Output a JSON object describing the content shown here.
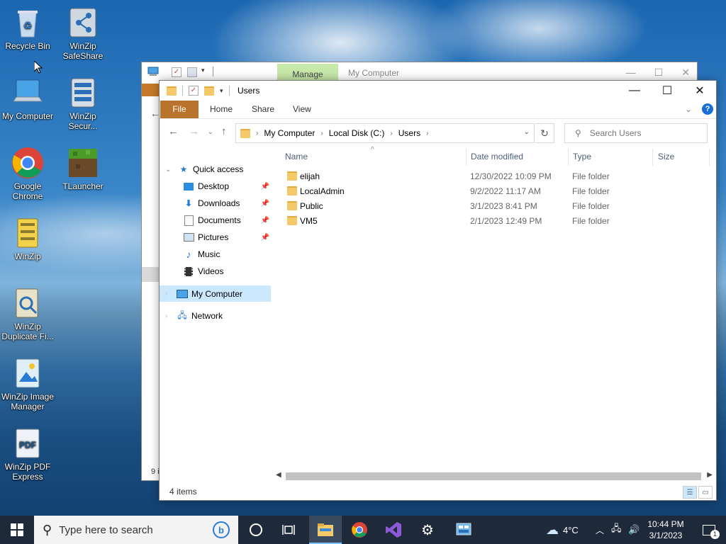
{
  "desktop_icons": [
    {
      "label": "Recycle Bin",
      "icon": "recycle-bin-icon"
    },
    {
      "label": "WinZip SafeShare",
      "icon": "winzip-safeshare-icon"
    },
    {
      "label": "My Computer",
      "icon": "computer-icon"
    },
    {
      "label": "WinZip Secur...",
      "icon": "winzip-secure-icon"
    },
    {
      "label": "Google Chrome",
      "icon": "chrome-icon"
    },
    {
      "label": "TLauncher",
      "icon": "tlauncher-icon"
    },
    {
      "label": "WinZip",
      "icon": "winzip-icon"
    },
    {
      "label": "WinZip Duplicate Fi...",
      "icon": "winzip-duplicate-icon"
    },
    {
      "label": "WinZip Image Manager",
      "icon": "winzip-image-icon"
    },
    {
      "label": "WinZip PDF Express",
      "icon": "winzip-pdf-icon"
    }
  ],
  "back_window": {
    "manage_tab": "Manage",
    "title": "My Computer",
    "status": "9 i"
  },
  "window": {
    "title": "Users",
    "ribbon_tabs": {
      "file": "File",
      "home": "Home",
      "share": "Share",
      "view": "View"
    },
    "help": "?",
    "address": {
      "seg1": "My Computer",
      "seg2": "Local Disk (C:)",
      "seg3": "Users"
    },
    "search_placeholder": "Search Users",
    "nav": {
      "quick_access": "Quick access",
      "desktop": "Desktop",
      "downloads": "Downloads",
      "documents": "Documents",
      "pictures": "Pictures",
      "music": "Music",
      "videos": "Videos",
      "my_computer": "My Computer",
      "network": "Network"
    },
    "columns": {
      "name": "Name",
      "date": "Date modified",
      "type": "Type",
      "size": "Size"
    },
    "files": [
      {
        "name": "elijah",
        "date": "12/30/2022 10:09 PM",
        "type": "File folder"
      },
      {
        "name": "LocalAdmin",
        "date": "9/2/2022 11:17 AM",
        "type": "File folder"
      },
      {
        "name": "Public",
        "date": "3/1/2023 8:41 PM",
        "type": "File folder"
      },
      {
        "name": "VM5",
        "date": "2/1/2023 12:49 PM",
        "type": "File folder"
      }
    ],
    "status_count": "4 items"
  },
  "taskbar": {
    "search_placeholder": "Type here to search",
    "weather": "4°C",
    "time": "10:44 PM",
    "date": "3/1/2023",
    "notification_count": "1"
  }
}
